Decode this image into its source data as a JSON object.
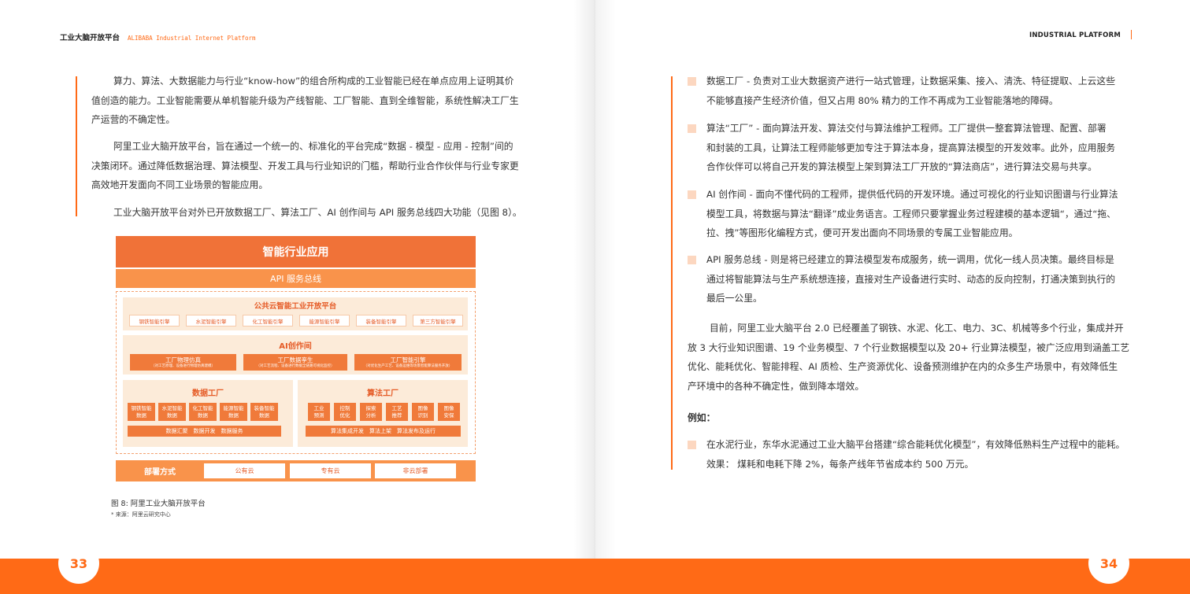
{
  "header": {
    "left_title": "工业大脑开放平台",
    "left_subtitle": "ALIBABA Industrial Internet Platform",
    "right_title": "INDUSTRIAL PLATFORM"
  },
  "left_page": {
    "page_number": "33",
    "paragraphs": [
      [
        "算力、算法、大数据能力与行业“know-how”的组合所构成的工业智能已经在单点应用上证明其价",
        "值创造的能力。工业智能需要从单机智能升级为产线智能、工厂智能、直到全维智能，系统性解决工厂生",
        "产运营的不确定性。"
      ],
      [
        "阿里工业大脑开放平台，旨在通过一个统一的、标准化的平台完成“数据 - 模型 - 应用 - 控制”间的",
        "决策闭环。通过降低数据治理、算法模型、开发工具与行业知识的门槛，帮助行业合作伙伴与行业专家更",
        "高效地开发面向不同工业场景的智能应用。"
      ],
      [
        "工业大脑开放平台对外已开放数据工厂、算法工厂、AI 创作间与 API 服务总线四大功能（见图 8）。"
      ]
    ],
    "diagram": {
      "top_title": "智能行业应用",
      "api_bus": "API 服务总线",
      "cloud_platform": {
        "title": "公共云智能工业开放平台",
        "engines": [
          "钢铁智能引擎",
          "水泥智能引擎",
          "化工智能引擎",
          "能源智能引擎",
          "装备智能引擎",
          "第三方智能引擎"
        ]
      },
      "ai_studio": {
        "title": "AI创作间",
        "items": [
          {
            "title": "工厂物理仿真",
            "desc": "（对工艺原理、设备进行物理仿真建模）"
          },
          {
            "title": "工厂数据孪生",
            "desc": "（对工艺流程、设备进行数据全链路可视化监控）"
          },
          {
            "title": "工厂智能引擎",
            "desc": "（对优化生产工艺、设备运维等场景智能算法服务开放）"
          }
        ]
      },
      "data_factory": {
        "title": "数据工厂",
        "items": [
          [
            "钢铁智能",
            "数据"
          ],
          [
            "水泥智能",
            "数据"
          ],
          [
            "化工智能",
            "数据"
          ],
          [
            "能源智能",
            "数据"
          ],
          [
            "装备智能",
            "数据"
          ]
        ],
        "footer": "数据汇聚　数据开发　数据服务"
      },
      "algo_factory": {
        "title": "算法工厂",
        "items": [
          [
            "工业",
            "预测"
          ],
          [
            "控制",
            "优化"
          ],
          [
            "探索",
            "分析"
          ],
          [
            "工艺",
            "推荐"
          ],
          [
            "图像",
            "识别"
          ],
          [
            "图像",
            "安保"
          ]
        ],
        "footer": "算法集成开发　算法上架　算法发布及运行"
      },
      "deployment": {
        "label": "部署方式",
        "options": [
          "公有云",
          "专有云",
          "非云部署"
        ]
      }
    },
    "caption": "图 8: 阿里工业大脑开放平台",
    "source": "* 来源：阿里云研究中心"
  },
  "right_page": {
    "page_number": "34",
    "bullets": [
      [
        "数据工厂 - 负责对工业大数据资产进行一站式管理，让数据采集、接入、清洗、特征提取、上云这些",
        "不能够直接产生经济价值，但又占用 80% 精力的工作不再成为工业智能落地的障碍。"
      ],
      [
        "算法“工厂” - 面向算法开发、算法交付与算法维护工程师。工厂提供一整套算法管理、配置、部署",
        "和封装的工具，让算法工程师能够更加专注于算法本身，提高算法模型的开发效率。此外，应用服务",
        "合作伙伴可以将自己开发的算法模型上架到算法工厂开放的“算法商店”，进行算法交易与共享。"
      ],
      [
        "AI 创作间 - 面向不懂代码的工程师，提供低代码的开发环境。通过可视化的行业知识图谱与行业算法",
        "模型工具，将数据与算法“翻译”成业务语言。工程师只要掌握业务过程建模的基本逻辑“，通过“拖、",
        "拉、拽”等图形化编程方式，便可开发出面向不同场景的专属工业智能应用。"
      ],
      [
        "API 服务总线 - 则是将已经建立的算法模型发布成服务，统一调用，优化一线人员决策。最终目标是",
        "通过将智能算法与生产系统想连接，直接对生产设备进行实时、动态的反向控制，打通决策到执行的",
        "最后一公里。"
      ]
    ],
    "paragraph": [
      "目前，阿里工业大脑平台 2.0 已经覆盖了钢铁、水泥、化工、电力、3C、机械等多个行业，集成并开",
      "放 3 大行业知识图谱、19 个业务模型、7 个行业数据模型以及 20+ 行业算法模型，被广泛应用到涵盖工艺",
      "优化、能耗优化、智能排程、AI 质检、生产资源优化、设备预测维护在内的众多生产场景中，有效降低生",
      "产环境中的各种不确定性，做到降本增效。"
    ],
    "example_label": "例如：",
    "example": [
      "在水泥行业，东华水泥通过工业大脑平台搭建“综合能耗优化模型”，有效降低熟料生产过程中的能耗。",
      "效果：  煤耗和电耗下降 2%，每条产线年节省成本约 500 万元。"
    ]
  }
}
